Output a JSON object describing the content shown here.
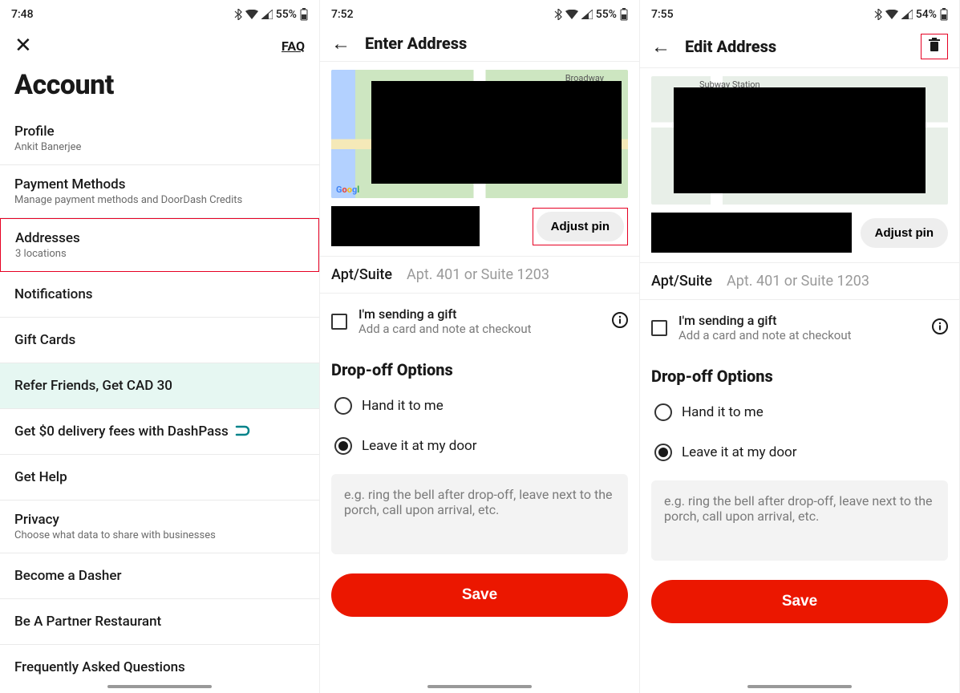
{
  "screens": [
    {
      "status": {
        "time": "7:48",
        "battery": "55%"
      },
      "faq": "FAQ",
      "title": "Account",
      "items": [
        {
          "title": "Profile",
          "subtitle": "Ankit Banerjee"
        },
        {
          "title": "Payment Methods",
          "subtitle": "Manage payment methods and DoorDash Credits"
        },
        {
          "title": "Addresses",
          "subtitle": "3 locations",
          "highlighted": true
        },
        {
          "title": "Notifications"
        },
        {
          "title": "Gift Cards"
        },
        {
          "title": "Refer Friends, Get CAD 30",
          "refer": true
        },
        {
          "title": "Get $0 delivery fees with DashPass",
          "dashpass": true
        },
        {
          "title": "Get Help"
        },
        {
          "title": "Privacy",
          "subtitle": "Choose what data to share with businesses"
        },
        {
          "title": "Become a Dasher"
        },
        {
          "title": "Be A Partner Restaurant"
        },
        {
          "title": "Frequently Asked Questions"
        }
      ]
    },
    {
      "status": {
        "time": "7:52",
        "battery": "55%"
      },
      "header": "Enter Address",
      "adjust_pin": "Adjust pin",
      "adjust_highlighted": true,
      "apt": {
        "label": "Apt/Suite",
        "placeholder": "Apt. 401 or Suite 1203"
      },
      "gift": {
        "title": "I'm sending a gift",
        "subtitle": "Add a card and note at checkout"
      },
      "dropoff_title": "Drop-off Options",
      "options": [
        {
          "label": "Hand it to me",
          "selected": false
        },
        {
          "label": "Leave it at my door",
          "selected": true
        }
      ],
      "note_placeholder": "e.g. ring the bell after drop-off, leave next to the porch, call upon arrival, etc.",
      "save": "Save",
      "map_label": "Broadway"
    },
    {
      "status": {
        "time": "7:55",
        "battery": "54%"
      },
      "header": "Edit Address",
      "show_trash": true,
      "adjust_pin": "Adjust pin",
      "adjust_highlighted": false,
      "apt": {
        "label": "Apt/Suite",
        "placeholder": "Apt. 401 or Suite 1203"
      },
      "gift": {
        "title": "I'm sending a gift",
        "subtitle": "Add a card and note at checkout"
      },
      "dropoff_title": "Drop-off Options",
      "options": [
        {
          "label": "Hand it to me",
          "selected": false
        },
        {
          "label": "Leave it at my door",
          "selected": true
        }
      ],
      "note_placeholder": "e.g. ring the bell after drop-off, leave next to the porch, call upon arrival, etc.",
      "save": "Save",
      "map_label": "Subway Station"
    }
  ]
}
